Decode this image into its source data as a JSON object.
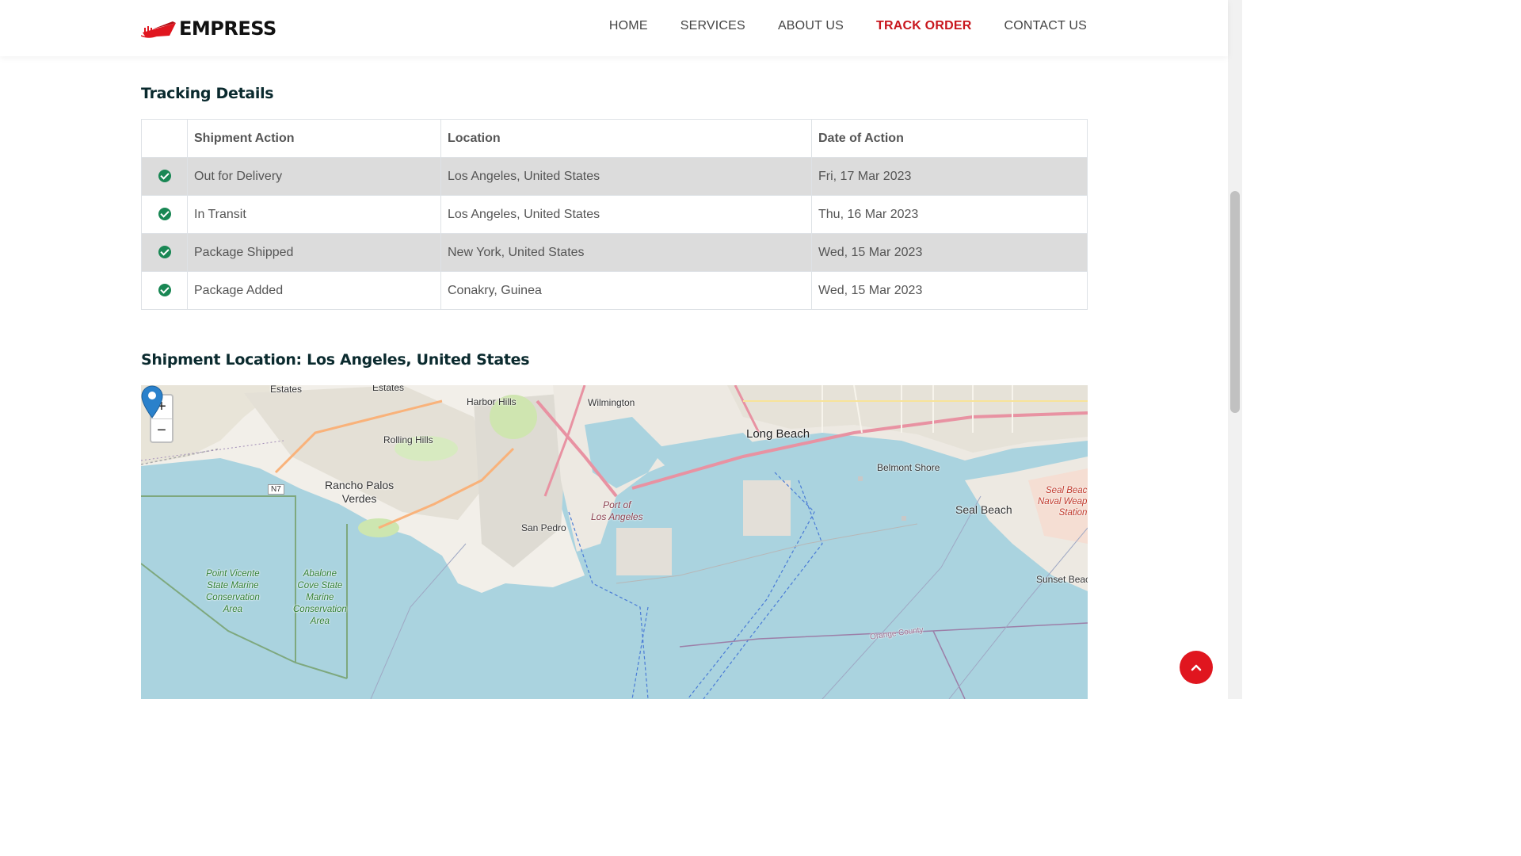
{
  "brand": {
    "name": "EMPRESS",
    "accent": "#c8161d"
  },
  "nav": {
    "items": [
      {
        "label": "HOME",
        "active": false
      },
      {
        "label": "SERVICES",
        "active": false
      },
      {
        "label": "ABOUT US",
        "active": false
      },
      {
        "label": "TRACK ORDER",
        "active": true
      },
      {
        "label": "CONTACT US",
        "active": false
      }
    ]
  },
  "tracking": {
    "title": "Tracking Details",
    "headers": [
      "",
      "Shipment Action",
      "Location",
      "Date of Action"
    ],
    "rows": [
      {
        "icon": "check-circle-icon",
        "action": "Out for Delivery",
        "location": "Los Angeles, United States",
        "date": "Fri, 17 Mar 2023"
      },
      {
        "icon": "check-circle-icon",
        "action": "In Transit",
        "location": "Los Angeles, United States",
        "date": "Thu, 16 Mar 2023"
      },
      {
        "icon": "check-circle-icon",
        "action": "Package Shipped",
        "location": "New York, United States",
        "date": "Wed, 15 Mar 2023"
      },
      {
        "icon": "check-circle-icon",
        "action": "Package Added",
        "location": "Conakry, Guinea",
        "date": "Wed, 15 Mar 2023"
      }
    ]
  },
  "shipment": {
    "title": "Shipment Location: Los Angeles, United States"
  },
  "map": {
    "zoom_in": "+",
    "zoom_out": "−",
    "labels": {
      "estates_1": "Estates",
      "estates_2": "Estates",
      "harbor_hills": "Harbor Hills",
      "wilmington": "Wilmington",
      "long_beach": "Long Beach",
      "rolling_hills": "Rolling Hills",
      "rancho": "Rancho Palos\nVerdes",
      "san_pedro": "San Pedro",
      "port": "Port of\nLos Angeles",
      "belmont": "Belmont Shore",
      "seal_beach": "Seal Beach",
      "naval": "Seal Beac\nNaval Weap\nStation",
      "sunset": "Sunset Beac",
      "point_vicente": "Point Vicente\nState Marine\nConservation\nArea",
      "abalone": "Abalone\nCove State\nMarine\nConservation\nArea",
      "orange_county": "Orange County",
      "n7": "N7"
    }
  }
}
